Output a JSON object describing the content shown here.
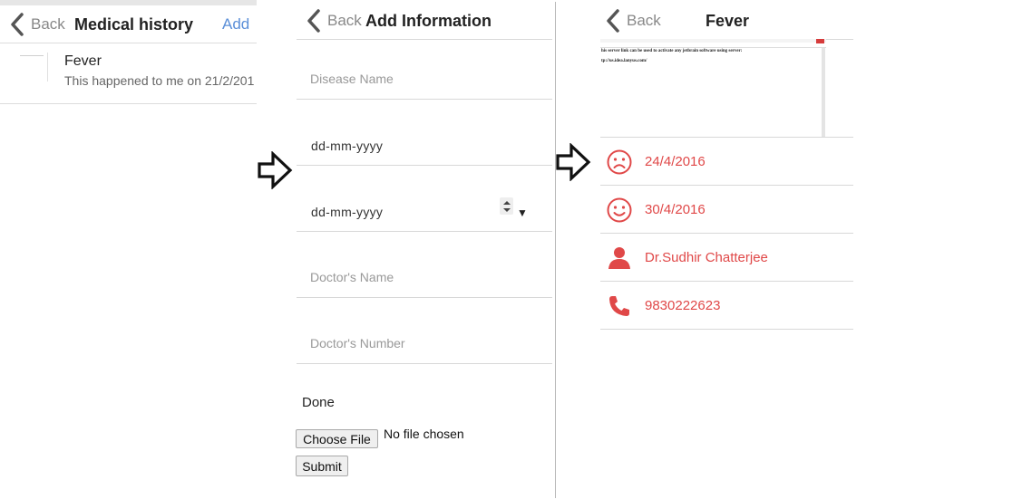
{
  "history": {
    "back_label": "Back",
    "title": "Medical history",
    "add_label": "Add",
    "items": [
      {
        "title": "Fever",
        "subtitle": "This happened to me on 21/2/201"
      }
    ]
  },
  "add_info": {
    "back_label": "Back",
    "title": "Add Information",
    "disease_placeholder": "Disease Name",
    "date_from_value": "dd-mm-yyyy",
    "date_to_value": "dd-mm-yyyy",
    "doctor_name_placeholder": "Doctor's Name",
    "doctor_number_placeholder": "Doctor's Number",
    "done_label": "Done",
    "choose_file_label": "Choose File",
    "file_status": "No file chosen",
    "submit_label": "Submit"
  },
  "detail": {
    "back_label": "Back",
    "title": "Fever",
    "attachment_lines": [
      "his server link can be used to activate any jetbrain software using server:",
      "tp://us.idea.lanyus.com/"
    ],
    "rows": [
      {
        "icon": "sad-face-icon",
        "text": "24/4/2016"
      },
      {
        "icon": "smiley-face-icon",
        "text": "30/4/2016"
      },
      {
        "icon": "person-icon",
        "text": "Dr.Sudhir Chatterjee"
      },
      {
        "icon": "phone-icon",
        "text": "9830222623"
      }
    ]
  },
  "colors": {
    "accent": "#e04848",
    "link": "#5b8fd8",
    "back": "#888888"
  }
}
